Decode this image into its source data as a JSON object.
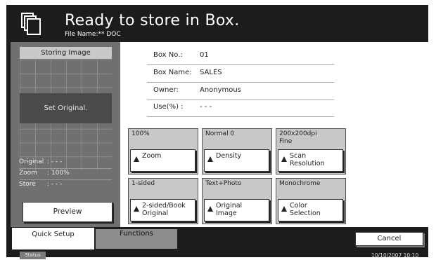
{
  "header": {
    "title": "Ready to store in Box.",
    "file_label": "File Name:",
    "file_name": "** DOC",
    "icon": "folder-stack-icon"
  },
  "storing_image": {
    "title": "Storing Image",
    "placeholder": "Set Original.",
    "info": [
      {
        "key": "Original",
        "value": ": - - -"
      },
      {
        "key": "Zoom",
        "value": ": 100%"
      },
      {
        "key": "Store",
        "value": ": - - -"
      }
    ],
    "preview_label": "Preview"
  },
  "box": {
    "fields": [
      {
        "label": "Box No.:",
        "value": "01"
      },
      {
        "label": "Box Name:",
        "value": "SALES"
      },
      {
        "label": "Owner:",
        "value": "Anonymous"
      },
      {
        "label": "Use(%) :",
        "value": "- - -"
      }
    ]
  },
  "settings": [
    {
      "value": "100%",
      "button": "Zoom"
    },
    {
      "value": "Normal 0",
      "button": "Density"
    },
    {
      "value": "200x200dpi\nFine",
      "button": "Scan\nResolution"
    },
    {
      "value": "1-sided",
      "button": "2-sided/Book\nOriginal"
    },
    {
      "value": "Text+Photo",
      "button": "Original\nImage"
    },
    {
      "value": "Monochrome",
      "button": "Color\nSelection"
    }
  ],
  "tabs": [
    {
      "label": "Quick Setup",
      "active": true
    },
    {
      "label": "Functions",
      "active": false
    }
  ],
  "cancel_label": "Cancel",
  "status_label": "Status",
  "datetime": "10/10/2007   10:10",
  "colors": {
    "frame": "#1c1c1c",
    "panel": "#707070",
    "group": "#c8c8c8"
  }
}
